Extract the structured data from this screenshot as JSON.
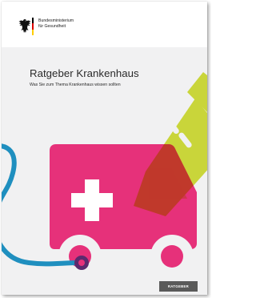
{
  "masthead": {
    "ministry_line1": "Bundesministerium",
    "ministry_line2": "für Gesundheit",
    "flag_colors": [
      "#000000",
      "#dd0000",
      "#ffcc00"
    ]
  },
  "cover": {
    "title": "Ratgeber Krankenhaus",
    "subtitle": "Was Sie zum Thema Krankenhaus wissen sollten",
    "badge": "RATGEBER"
  },
  "illustration": {
    "subject": "ambulance-with-syringe-and-stethoscope",
    "colors": {
      "ambulance": "#e6317a",
      "syringe": "#c9d53a",
      "overlap": "#c0392b",
      "stethoscope": "#1f8fbf",
      "wheel_hub": "#5b2a6e",
      "background": "#f1f1f2"
    }
  }
}
